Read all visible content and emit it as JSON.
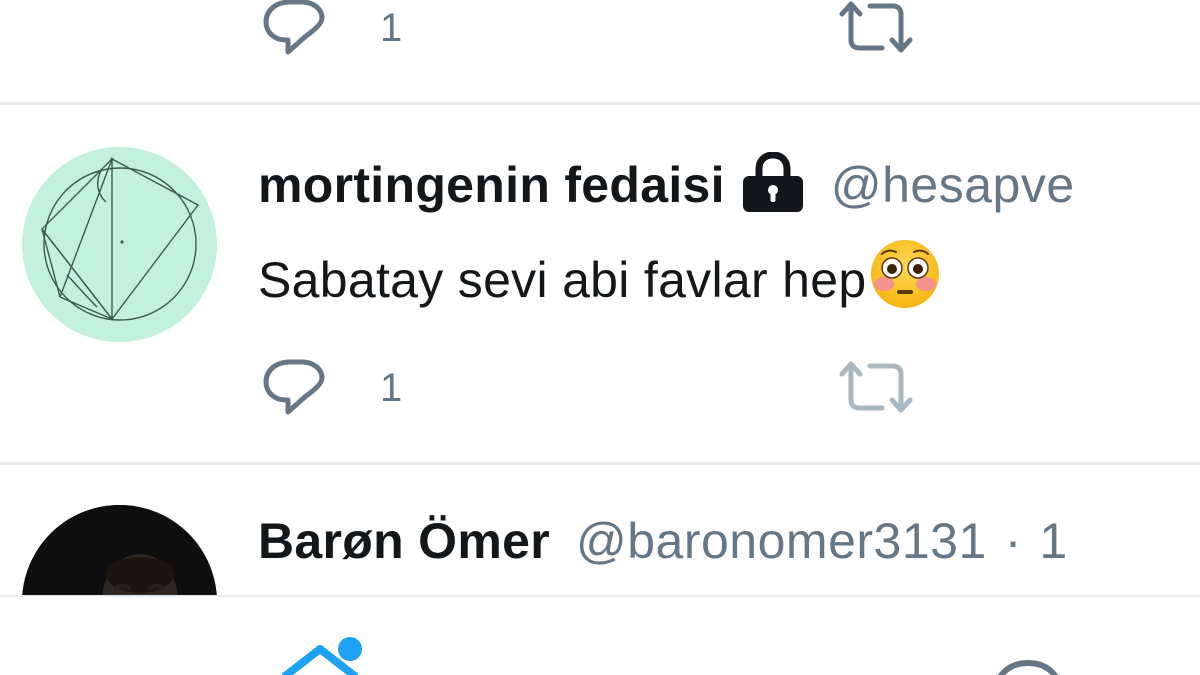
{
  "previous_tweet": {
    "reply_count": "1",
    "icons": [
      "reply-icon",
      "retweet-icon"
    ]
  },
  "tweet_1": {
    "display_name": "mortingenin fedaisi",
    "handle": "@hesapve",
    "text": "Sabatay sevi abi favlar hep",
    "emoji": "flushed-face-emoji",
    "reply_count": "1",
    "protected_icon": "lock-icon",
    "avatar": "geometric-circle-diagram-avatar"
  },
  "tweet_2": {
    "display_name": "Barøn Ömer",
    "handle": "@baronomer3131",
    "separator": "·",
    "time": "1"
  },
  "bottom_nav": {
    "icons": [
      "home-icon",
      "search-icon"
    ],
    "accent": "#1da1f2"
  },
  "colors": {
    "primary_text": "#14171a",
    "secondary_text": "#657786",
    "divider": "#e6ecf0",
    "avatar_bg": "#c3f1de",
    "accent": "#1da1f2"
  }
}
